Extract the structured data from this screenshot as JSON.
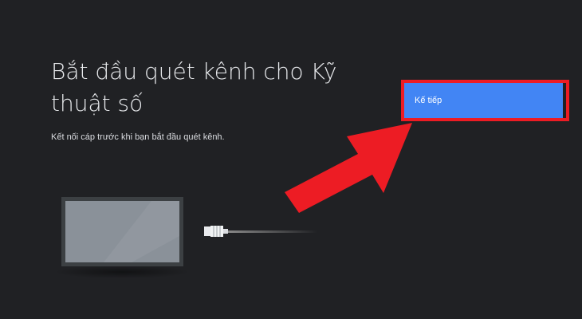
{
  "screen": {
    "title": "Bắt đầu quét kênh cho Kỹ thuật số",
    "description": "Kết nối cáp trước khi bạn bắt đầu quét kênh."
  },
  "actions": {
    "next_label": "Kế tiếp"
  },
  "annotations": {
    "highlight_color": "#ed1c24",
    "arrow_color": "#ed1c24",
    "arrow_icon": "red-arrow-pointing-to-next-button"
  },
  "illustration": {
    "icons": [
      "tv-icon",
      "cable-connector-icon",
      "cable-icon"
    ]
  },
  "colors": {
    "background": "#202124",
    "button": "#4285f4",
    "text": "#e8eaed"
  }
}
